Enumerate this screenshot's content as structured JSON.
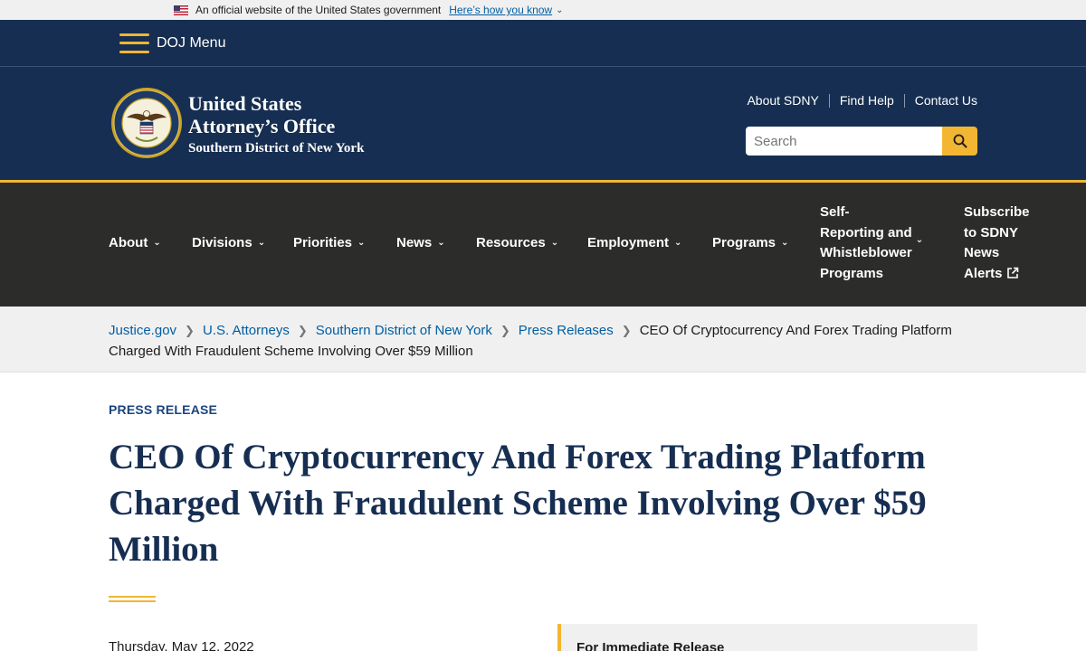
{
  "gov_banner": {
    "text": "An official website of the United States government",
    "link": "Here’s how you know"
  },
  "doj_bar": {
    "menu_label": "DOJ Menu"
  },
  "header": {
    "office_line1a": "United States",
    "office_line1b": "Attorney’s Office",
    "office_line2": "Southern District of New York",
    "utility_links": [
      "About SDNY",
      "Find Help",
      "Contact Us"
    ],
    "search_placeholder": "Search"
  },
  "main_nav": {
    "about": "About",
    "divisions": "Divisions",
    "priorities": "Priorities",
    "news": "News",
    "resources": "Resources",
    "employment": "Employment",
    "programs": "Programs",
    "self_reporting": [
      "Self-",
      "Reporting and",
      "Whistleblower",
      "Programs"
    ],
    "subscribe": [
      "Subscribe",
      "to SDNY",
      "News",
      "Alerts"
    ]
  },
  "breadcrumb": {
    "items": [
      "Justice.gov",
      "U.S. Attorneys",
      "Southern District of New York",
      "Press Releases"
    ],
    "current": "CEO Of Cryptocurrency And Forex Trading Platform Charged With Fraudulent Scheme Involving Over $59 Million"
  },
  "article": {
    "label": "PRESS RELEASE",
    "title": "CEO Of Cryptocurrency And Forex Trading Platform Charged With Fraudulent Scheme Involving Over $59 Million",
    "date": "Thursday, May 12, 2022",
    "release_label": "For Immediate Release"
  },
  "colors": {
    "navy": "#162e51",
    "gold": "#f2b632",
    "nav_dark": "#2c2c2a",
    "link_blue": "#005ea2"
  }
}
